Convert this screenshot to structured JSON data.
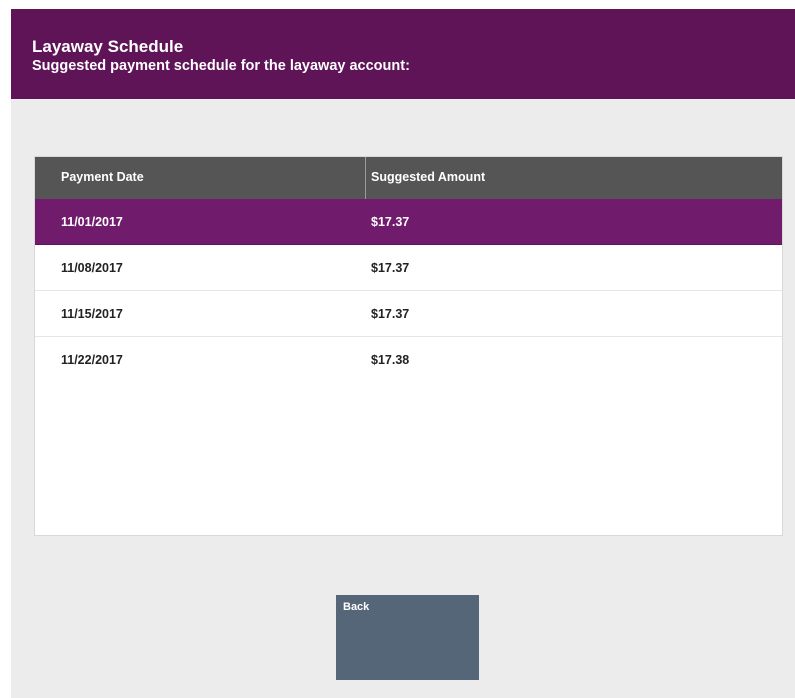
{
  "header": {
    "title": "Layaway Schedule",
    "subtitle": "Suggested payment schedule for the layaway account:"
  },
  "table": {
    "columns": [
      "Payment Date",
      "Suggested Amount"
    ],
    "rows": [
      {
        "date": "11/01/2017",
        "amount": "$17.37",
        "selected": true
      },
      {
        "date": "11/08/2017",
        "amount": "$17.37",
        "selected": false
      },
      {
        "date": "11/15/2017",
        "amount": "$17.37",
        "selected": false
      },
      {
        "date": "11/22/2017",
        "amount": "$17.38",
        "selected": false
      }
    ]
  },
  "actions": {
    "back_label": "Back"
  },
  "colors": {
    "header_bg": "#5f1457",
    "selected_row_bg": "#701b6b",
    "table_header_bg": "#555555",
    "button_bg": "#556678",
    "page_bg": "#ececec"
  }
}
